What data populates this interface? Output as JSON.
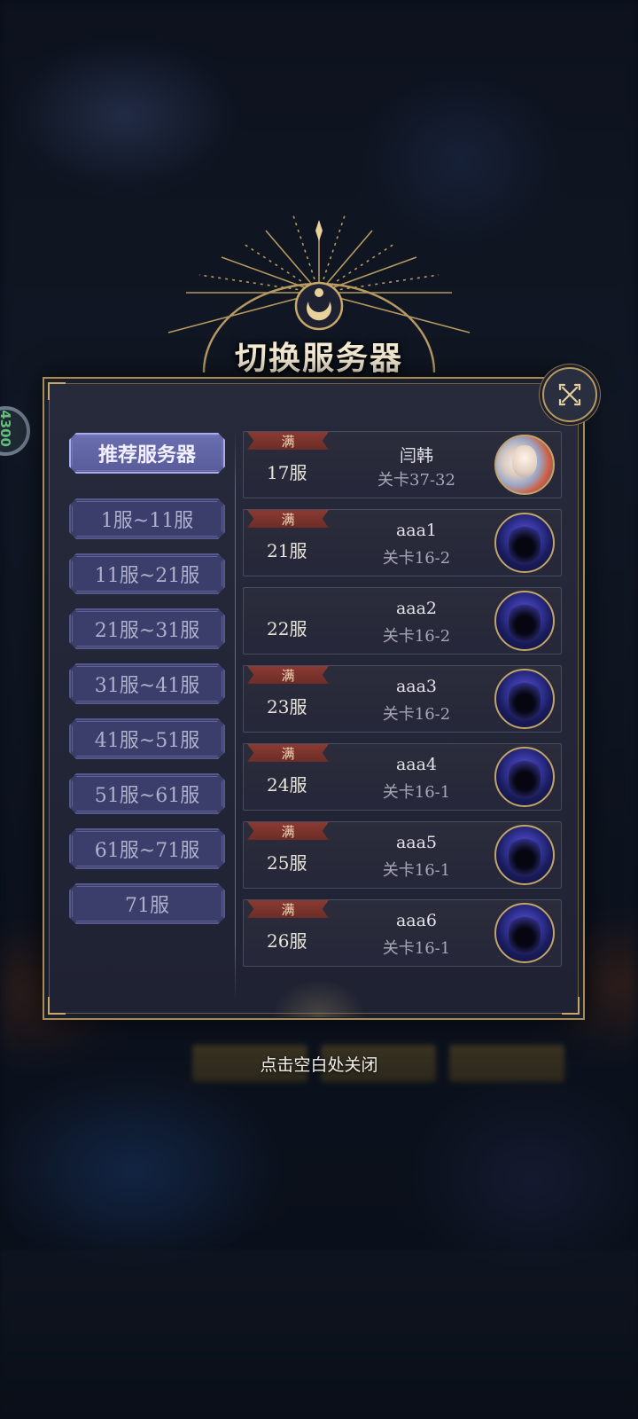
{
  "dialog": {
    "title": "切换服务器",
    "close_hint": "点击空白处关闭"
  },
  "background": {
    "badge_value": "4300"
  },
  "categories": [
    {
      "label": "推荐服务器",
      "active": true
    },
    {
      "label": "1服~11服",
      "active": false
    },
    {
      "label": "11服~21服",
      "active": false
    },
    {
      "label": "21服~31服",
      "active": false
    },
    {
      "label": "31服~41服",
      "active": false
    },
    {
      "label": "41服~51服",
      "active": false
    },
    {
      "label": "51服~61服",
      "active": false
    },
    {
      "label": "61服~71服",
      "active": false
    },
    {
      "label": "71服",
      "active": false
    }
  ],
  "servers": [
    {
      "tag": "满",
      "server": "17服",
      "player": "闫韩",
      "stage": "关卡37-32",
      "avatar": "hero-portrait"
    },
    {
      "tag": "满",
      "server": "21服",
      "player": "aaa1",
      "stage": "关卡16-2",
      "avatar": "hooded-figure"
    },
    {
      "tag": "",
      "server": "22服",
      "player": "aaa2",
      "stage": "关卡16-2",
      "avatar": "hooded-figure"
    },
    {
      "tag": "满",
      "server": "23服",
      "player": "aaa3",
      "stage": "关卡16-2",
      "avatar": "hooded-figure"
    },
    {
      "tag": "满",
      "server": "24服",
      "player": "aaa4",
      "stage": "关卡16-1",
      "avatar": "hooded-figure"
    },
    {
      "tag": "满",
      "server": "25服",
      "player": "aaa5",
      "stage": "关卡16-1",
      "avatar": "hooded-figure"
    },
    {
      "tag": "满",
      "server": "26服",
      "player": "aaa6",
      "stage": "关卡16-1",
      "avatar": "hooded-figure"
    }
  ],
  "colors": {
    "gold": "#c9a867",
    "category_active": "#6c6fb0",
    "category_idle": "#3b3d6b",
    "full_tag": "#8a3b33"
  }
}
